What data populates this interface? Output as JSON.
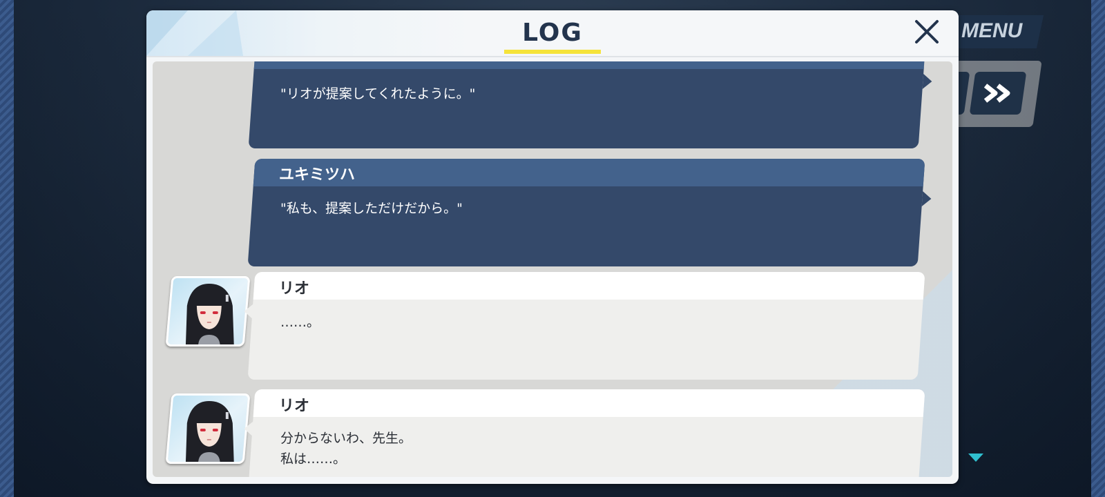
{
  "window": {
    "title": "LOG"
  },
  "controls": {
    "menu_label": "MENU"
  },
  "entries": [
    {
      "speaker": "",
      "type": "sensei",
      "text": "\"リオが提案してくれたように。\""
    },
    {
      "speaker": "ユキミツハ",
      "type": "sensei",
      "text": "\"私も、提案しただけだから。\""
    },
    {
      "speaker": "リオ",
      "type": "other",
      "text": "……。"
    },
    {
      "speaker": "リオ",
      "type": "other",
      "text": "分からないわ、先生。\n私は……。"
    }
  ],
  "colors": {
    "sensei_bubble": "#34496a",
    "sensei_name_band": "#43628c",
    "other_bubble": "#efefed",
    "title_underline": "#f5e33a",
    "title_text": "#23344d"
  }
}
